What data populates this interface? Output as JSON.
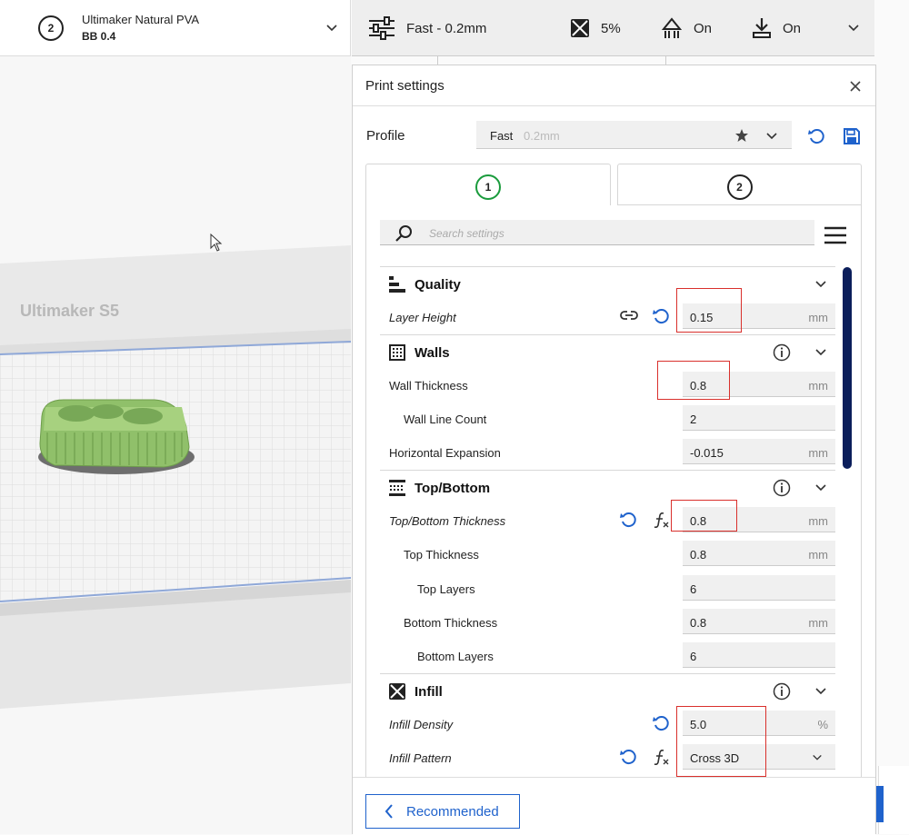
{
  "topbar": {
    "extruder_badge": "2",
    "material_name": "Ultimaker Natural PVA",
    "nozzle": "BB 0.4",
    "profile_summary": "Fast - 0.2mm",
    "infill_summary": "5%",
    "support_summary": "On",
    "adhesion_summary": "On"
  },
  "viewport": {
    "printer_name": "Ultimaker S5"
  },
  "panel": {
    "title": "Print settings",
    "close_icon": "close-icon",
    "profile_label": "Profile",
    "profile_name": "Fast",
    "profile_sub": "0.2mm",
    "extruder_tabs": [
      "1",
      "2"
    ],
    "search_placeholder": "Search settings",
    "recommended_label": "Recommended"
  },
  "settings": {
    "quality": {
      "title": "Quality",
      "layer_height": {
        "label": "Layer Height",
        "value": "0.15",
        "unit": "mm"
      }
    },
    "walls": {
      "title": "Walls",
      "wall_thickness": {
        "label": "Wall Thickness",
        "value": "0.8",
        "unit": "mm"
      },
      "wall_line_count": {
        "label": "Wall Line Count",
        "value": "2"
      },
      "horizontal_expansion": {
        "label": "Horizontal Expansion",
        "value": "-0.015",
        "unit": "mm"
      }
    },
    "topbottom": {
      "title": "Top/Bottom",
      "thickness": {
        "label": "Top/Bottom Thickness",
        "value": "0.8",
        "unit": "mm"
      },
      "top_thickness": {
        "label": "Top Thickness",
        "value": "0.8",
        "unit": "mm"
      },
      "top_layers": {
        "label": "Top Layers",
        "value": "6"
      },
      "bottom_thickness": {
        "label": "Bottom Thickness",
        "value": "0.8",
        "unit": "mm"
      },
      "bottom_layers": {
        "label": "Bottom Layers",
        "value": "6"
      }
    },
    "infill": {
      "title": "Infill",
      "density": {
        "label": "Infill Density",
        "value": "5.0",
        "unit": "%"
      },
      "pattern": {
        "label": "Infill Pattern",
        "value": "Cross 3D"
      }
    }
  },
  "colors": {
    "accent_blue": "#1f62cc",
    "scroll_thumb": "#0b1e5b",
    "model_green": "#8fbf6a",
    "highlight_red": "#d9302c",
    "active_extruder": "#1a9b3c"
  }
}
